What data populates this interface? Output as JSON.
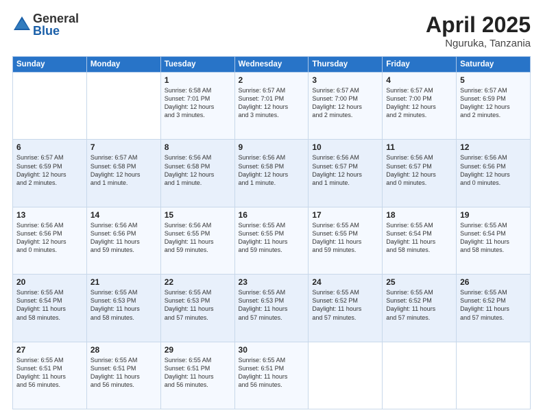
{
  "logo": {
    "general": "General",
    "blue": "Blue"
  },
  "header": {
    "month": "April 2025",
    "location": "Nguruka, Tanzania"
  },
  "weekdays": [
    "Sunday",
    "Monday",
    "Tuesday",
    "Wednesday",
    "Thursday",
    "Friday",
    "Saturday"
  ],
  "weeks": [
    [
      {
        "day": "",
        "info": ""
      },
      {
        "day": "",
        "info": ""
      },
      {
        "day": "1",
        "info": "Sunrise: 6:58 AM\nSunset: 7:01 PM\nDaylight: 12 hours\nand 3 minutes."
      },
      {
        "day": "2",
        "info": "Sunrise: 6:57 AM\nSunset: 7:01 PM\nDaylight: 12 hours\nand 3 minutes."
      },
      {
        "day": "3",
        "info": "Sunrise: 6:57 AM\nSunset: 7:00 PM\nDaylight: 12 hours\nand 2 minutes."
      },
      {
        "day": "4",
        "info": "Sunrise: 6:57 AM\nSunset: 7:00 PM\nDaylight: 12 hours\nand 2 minutes."
      },
      {
        "day": "5",
        "info": "Sunrise: 6:57 AM\nSunset: 6:59 PM\nDaylight: 12 hours\nand 2 minutes."
      }
    ],
    [
      {
        "day": "6",
        "info": "Sunrise: 6:57 AM\nSunset: 6:59 PM\nDaylight: 12 hours\nand 2 minutes."
      },
      {
        "day": "7",
        "info": "Sunrise: 6:57 AM\nSunset: 6:58 PM\nDaylight: 12 hours\nand 1 minute."
      },
      {
        "day": "8",
        "info": "Sunrise: 6:56 AM\nSunset: 6:58 PM\nDaylight: 12 hours\nand 1 minute."
      },
      {
        "day": "9",
        "info": "Sunrise: 6:56 AM\nSunset: 6:58 PM\nDaylight: 12 hours\nand 1 minute."
      },
      {
        "day": "10",
        "info": "Sunrise: 6:56 AM\nSunset: 6:57 PM\nDaylight: 12 hours\nand 1 minute."
      },
      {
        "day": "11",
        "info": "Sunrise: 6:56 AM\nSunset: 6:57 PM\nDaylight: 12 hours\nand 0 minutes."
      },
      {
        "day": "12",
        "info": "Sunrise: 6:56 AM\nSunset: 6:56 PM\nDaylight: 12 hours\nand 0 minutes."
      }
    ],
    [
      {
        "day": "13",
        "info": "Sunrise: 6:56 AM\nSunset: 6:56 PM\nDaylight: 12 hours\nand 0 minutes."
      },
      {
        "day": "14",
        "info": "Sunrise: 6:56 AM\nSunset: 6:56 PM\nDaylight: 11 hours\nand 59 minutes."
      },
      {
        "day": "15",
        "info": "Sunrise: 6:56 AM\nSunset: 6:55 PM\nDaylight: 11 hours\nand 59 minutes."
      },
      {
        "day": "16",
        "info": "Sunrise: 6:55 AM\nSunset: 6:55 PM\nDaylight: 11 hours\nand 59 minutes."
      },
      {
        "day": "17",
        "info": "Sunrise: 6:55 AM\nSunset: 6:55 PM\nDaylight: 11 hours\nand 59 minutes."
      },
      {
        "day": "18",
        "info": "Sunrise: 6:55 AM\nSunset: 6:54 PM\nDaylight: 11 hours\nand 58 minutes."
      },
      {
        "day": "19",
        "info": "Sunrise: 6:55 AM\nSunset: 6:54 PM\nDaylight: 11 hours\nand 58 minutes."
      }
    ],
    [
      {
        "day": "20",
        "info": "Sunrise: 6:55 AM\nSunset: 6:54 PM\nDaylight: 11 hours\nand 58 minutes."
      },
      {
        "day": "21",
        "info": "Sunrise: 6:55 AM\nSunset: 6:53 PM\nDaylight: 11 hours\nand 58 minutes."
      },
      {
        "day": "22",
        "info": "Sunrise: 6:55 AM\nSunset: 6:53 PM\nDaylight: 11 hours\nand 57 minutes."
      },
      {
        "day": "23",
        "info": "Sunrise: 6:55 AM\nSunset: 6:53 PM\nDaylight: 11 hours\nand 57 minutes."
      },
      {
        "day": "24",
        "info": "Sunrise: 6:55 AM\nSunset: 6:52 PM\nDaylight: 11 hours\nand 57 minutes."
      },
      {
        "day": "25",
        "info": "Sunrise: 6:55 AM\nSunset: 6:52 PM\nDaylight: 11 hours\nand 57 minutes."
      },
      {
        "day": "26",
        "info": "Sunrise: 6:55 AM\nSunset: 6:52 PM\nDaylight: 11 hours\nand 57 minutes."
      }
    ],
    [
      {
        "day": "27",
        "info": "Sunrise: 6:55 AM\nSunset: 6:51 PM\nDaylight: 11 hours\nand 56 minutes."
      },
      {
        "day": "28",
        "info": "Sunrise: 6:55 AM\nSunset: 6:51 PM\nDaylight: 11 hours\nand 56 minutes."
      },
      {
        "day": "29",
        "info": "Sunrise: 6:55 AM\nSunset: 6:51 PM\nDaylight: 11 hours\nand 56 minutes."
      },
      {
        "day": "30",
        "info": "Sunrise: 6:55 AM\nSunset: 6:51 PM\nDaylight: 11 hours\nand 56 minutes."
      },
      {
        "day": "",
        "info": ""
      },
      {
        "day": "",
        "info": ""
      },
      {
        "day": "",
        "info": ""
      }
    ]
  ]
}
